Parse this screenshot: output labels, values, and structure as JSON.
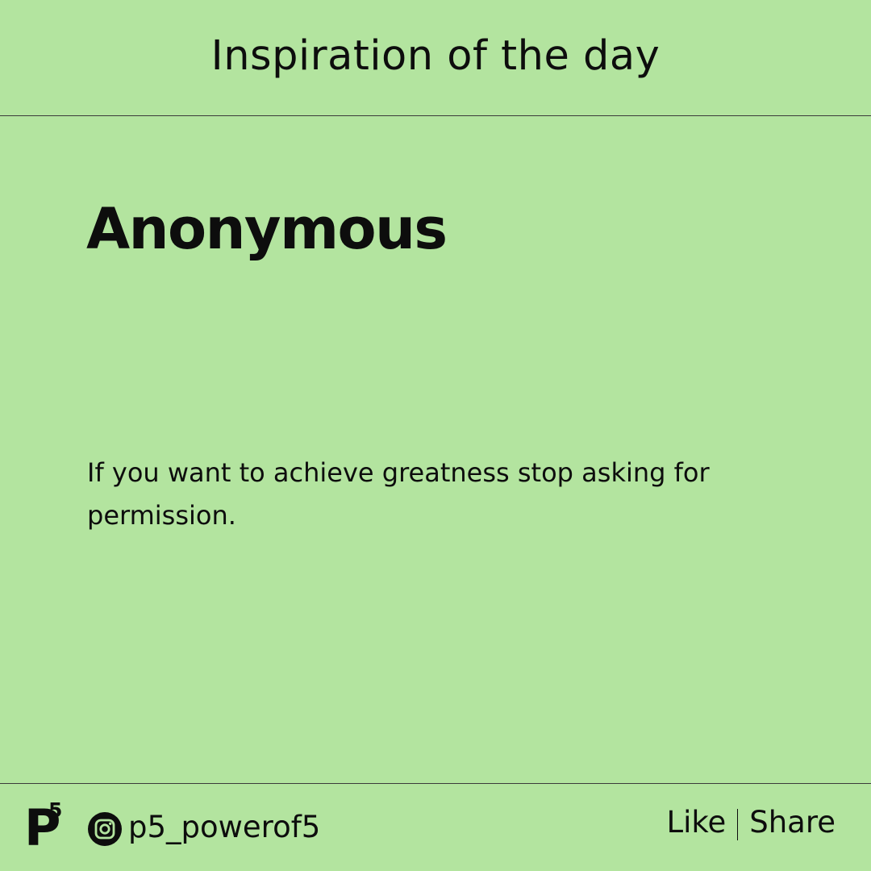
{
  "page": {
    "title": "Inspiration of the day",
    "background_color": "#b3e49f",
    "text_color": "#0d0d0d"
  },
  "quote": {
    "author": "Anonymous",
    "text": "If you want to achieve greatness stop asking for permission."
  },
  "footer": {
    "logo": {
      "letter": "P",
      "superscript": "5"
    },
    "social_icon": "instagram-icon",
    "handle": "p5_powerof5",
    "like_label": "Like",
    "separator": "|",
    "share_label": "Share"
  }
}
